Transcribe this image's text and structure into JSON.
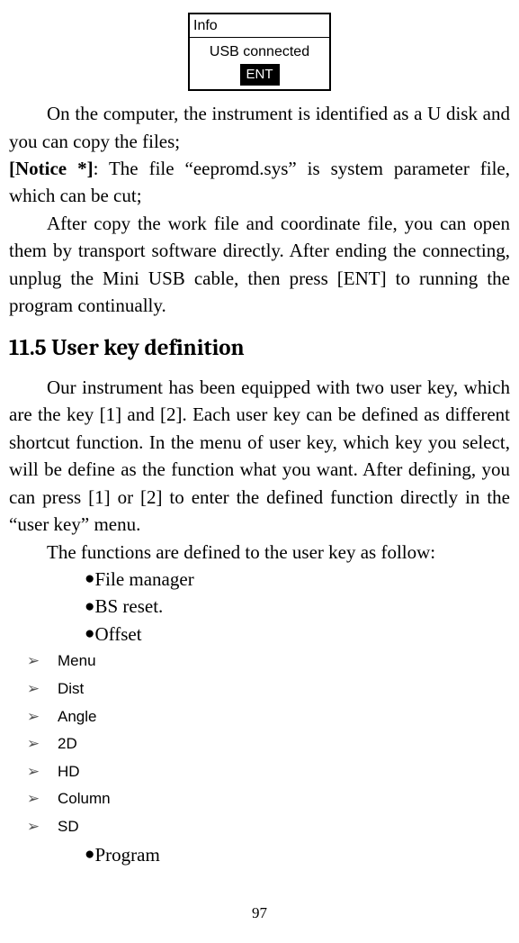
{
  "info_box": {
    "title": "Info",
    "line": "USB connected",
    "button": "ENT"
  },
  "p1a": "On the computer, the instrument is identified as a U disk and you can copy the files;",
  "notice_label": "[Notice *]",
  "notice_text": ": The file “eepromd.sys” is system parameter file, which can be cut;",
  "p2": "After copy the work file and coordinate file, you can open them by transport software directly. After ending the connecting, unplug the Mini USB cable, then press [ENT] to running the program continually.",
  "section_title": "11.5 User key definition",
  "p3": "Our instrument has been equipped with two user key, which are the key [1] and [2]. Each user key can be defined as different shortcut function. In the menu of user key, which key you select, will be define as the function what you want. After defining, you can press [1] or [2] to enter the defined function directly in the “user key” menu.",
  "p4": "The functions are defined to the user key as follow:",
  "bullets": {
    "b1": "File manager",
    "b2": "BS reset.",
    "b3": "Offset",
    "b4": "Program"
  },
  "sublist": {
    "s1": "Menu",
    "s2": "Dist",
    "s3": "Angle",
    "s4": "2D",
    "s5": "HD",
    "s6": "Column",
    "s7": "SD"
  },
  "page_number": "97"
}
